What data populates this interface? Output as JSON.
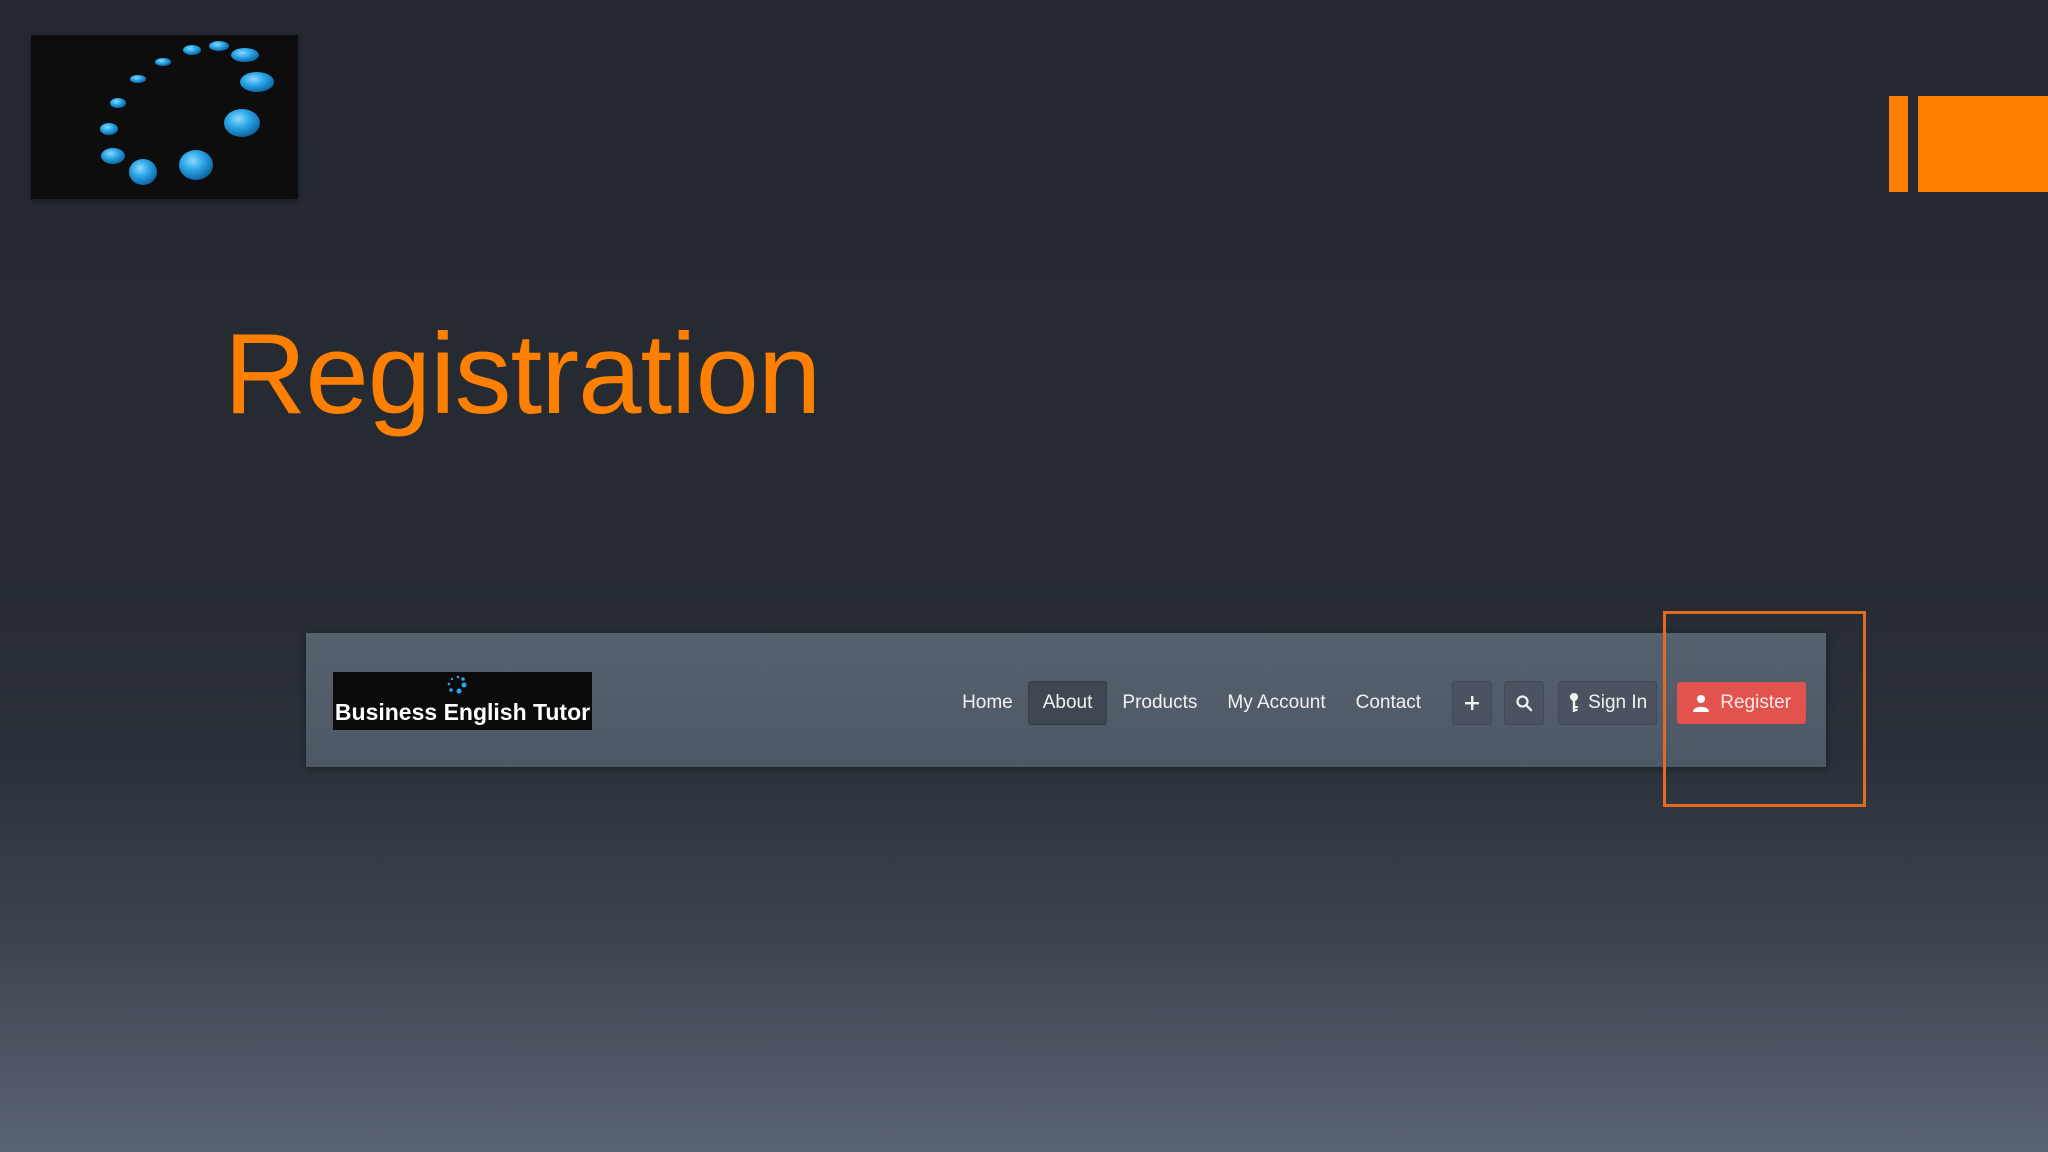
{
  "slide": {
    "title": "Registration",
    "accent_color": "#ff8000"
  },
  "corner_logo": {
    "icon": "spinner-dots-logo"
  },
  "navbar": {
    "brand": {
      "text": "Business English Tutor",
      "icon": "spinner-dots-logo"
    },
    "items": [
      {
        "label": "Home",
        "active": false
      },
      {
        "label": "About",
        "active": true
      },
      {
        "label": "Products",
        "active": false
      },
      {
        "label": "My Account",
        "active": false
      },
      {
        "label": "Contact",
        "active": false
      }
    ],
    "plus_icon": "plus-icon",
    "search_icon": "search-icon",
    "sign_in": {
      "label": "Sign In",
      "icon": "key-icon"
    },
    "register": {
      "label": "Register",
      "icon": "user-icon",
      "color": "#e2534f"
    }
  },
  "highlight": {
    "color": "#e36b1e"
  }
}
